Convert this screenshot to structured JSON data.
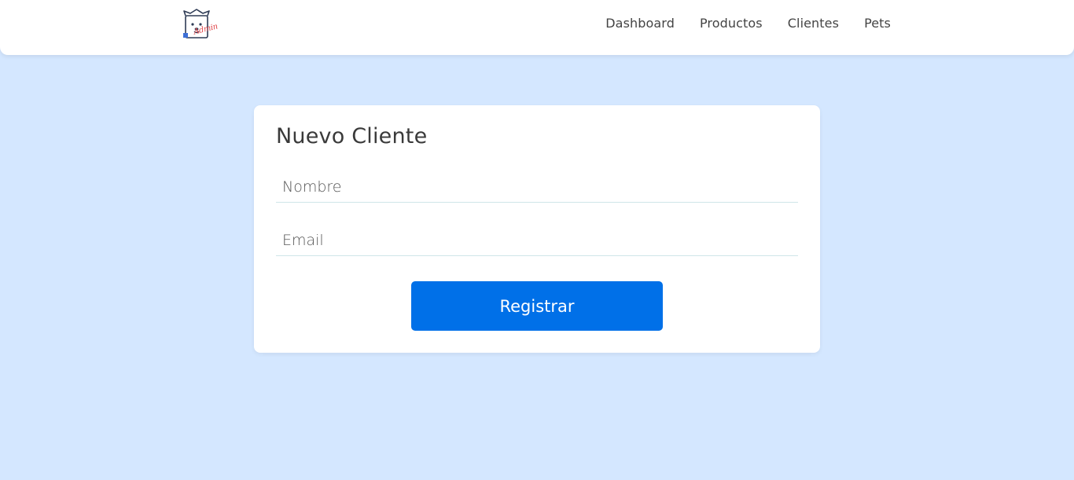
{
  "header": {
    "logo_icon": "dog-mascot-icon",
    "logo_text": "Admin",
    "nav": [
      "Dashboard",
      "Productos",
      "Clientes",
      "Pets"
    ]
  },
  "form": {
    "title": "Nuevo Cliente",
    "name_placeholder": "Nombre",
    "email_placeholder": "Email",
    "submit_label": "Registrar"
  },
  "colors": {
    "background": "#d4e7ff",
    "primary_button": "#0070e8",
    "logo_text": "#e0484c"
  }
}
